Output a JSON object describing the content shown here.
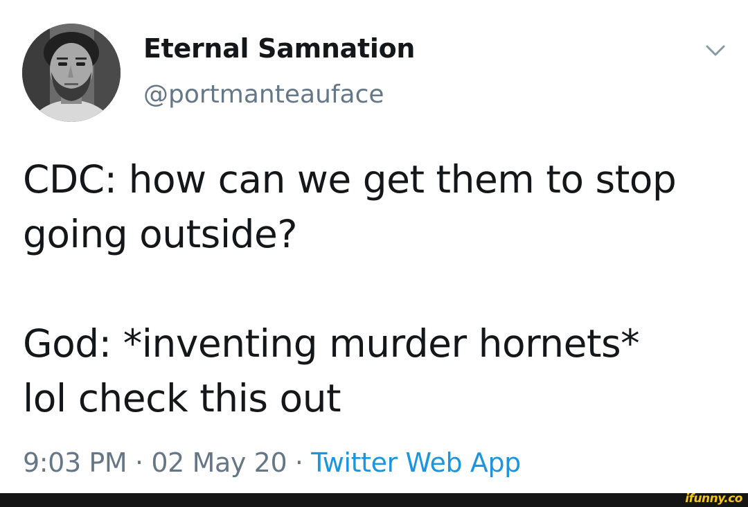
{
  "tweet": {
    "display_name": "Eternal Samnation",
    "handle": "@portmanteauface",
    "text": "CDC: how can we get them to stop\ngoing outside?\n\nGod: *inventing murder hornets*\nlol check this out",
    "time": "9:03 PM",
    "date": "02 May 20",
    "separator": "·",
    "source": "Twitter Web App"
  },
  "icons": {
    "menu": "chevron-down-icon",
    "avatar": "profile-photo"
  },
  "colors": {
    "text": "#14171a",
    "secondary": "#657786",
    "link": "#1b95e0",
    "footer": "#151515",
    "watermark": "#f5c518"
  },
  "watermark": "ifunny.co"
}
